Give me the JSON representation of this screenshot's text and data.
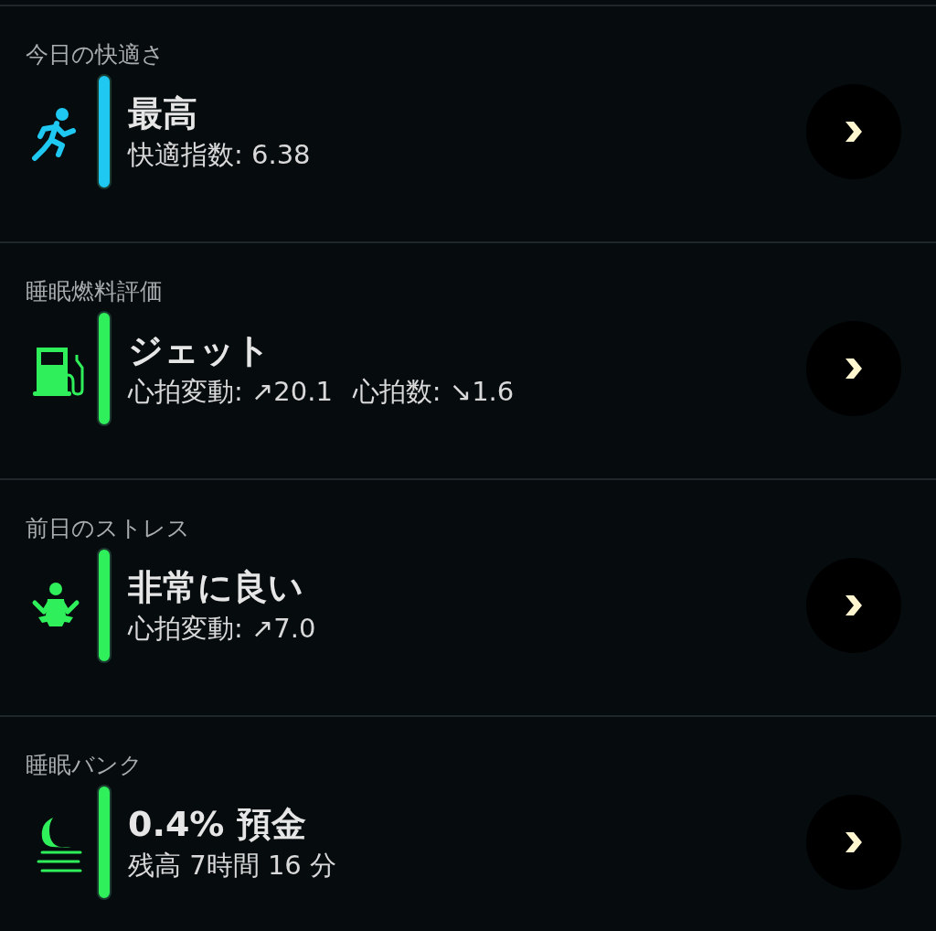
{
  "cards": [
    {
      "label": "今日の快適さ",
      "kind": "runner",
      "color": "#1ec8f0",
      "title": "最高",
      "details": [
        "快適指数: 6.38"
      ]
    },
    {
      "label": "睡眠燃料評価",
      "kind": "fuel",
      "color": "#2ff05a",
      "title": "ジェット",
      "details": [
        "心拍変動: ↗20.1",
        "心拍数: ↘1.6"
      ]
    },
    {
      "label": "前日のストレス",
      "kind": "meditation",
      "color": "#2ff05a",
      "title": "非常に良い",
      "details": [
        "心拍変動: ↗7.0"
      ]
    },
    {
      "label": "睡眠バンク",
      "kind": "moon",
      "color": "#2ff05a",
      "title": "0.4% 預金",
      "details": [
        "残高 7時間 16 分"
      ]
    }
  ]
}
